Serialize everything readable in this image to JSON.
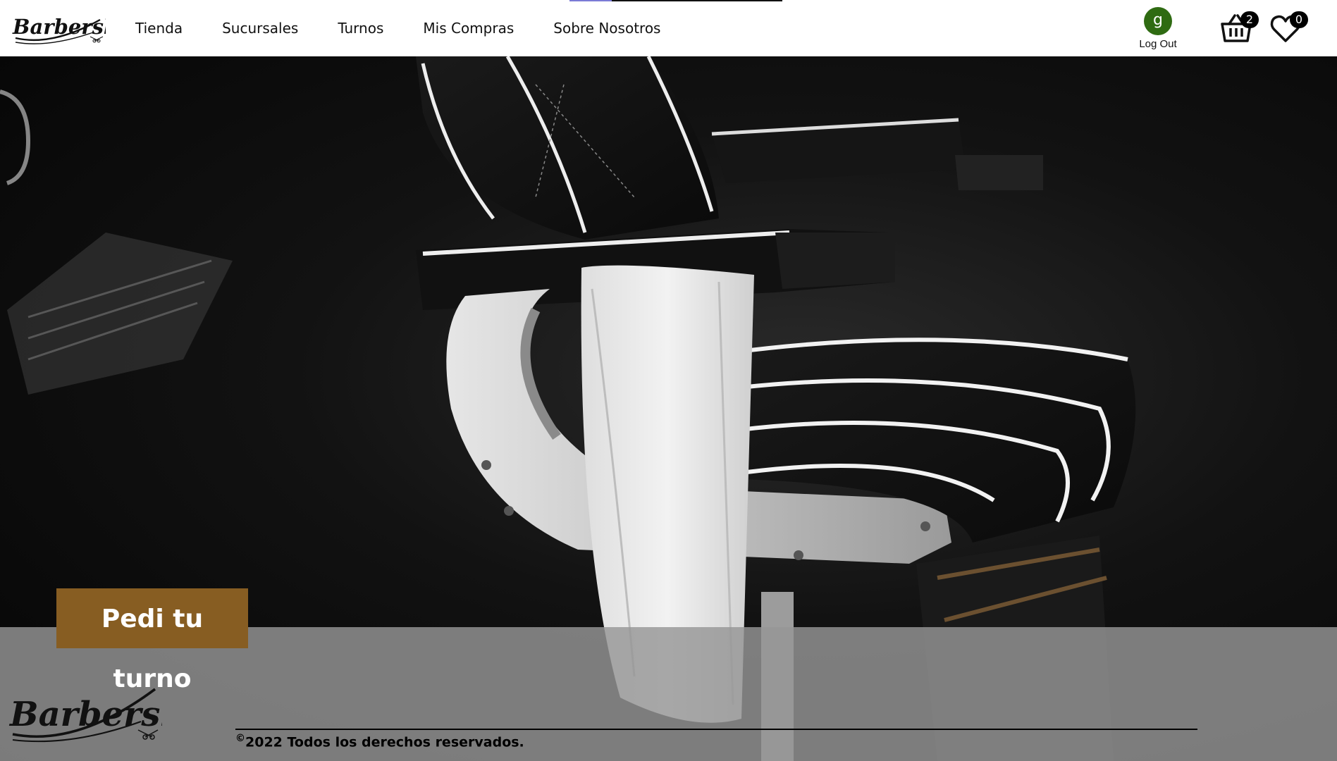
{
  "nav": {
    "brand": "Barbershop",
    "links": [
      "Tienda",
      "Sucursales",
      "Turnos",
      "Mis Compras",
      "Sobre Nosotros"
    ],
    "user": {
      "initial": "g",
      "logout_label": "Log Out",
      "avatar_color": "#2f6b12"
    },
    "cart": {
      "icon": "basket-icon",
      "count": "2"
    },
    "wishlist": {
      "icon": "heart-icon",
      "count": "0"
    }
  },
  "hero": {
    "image_icon": "barber-chair-photo",
    "cta_label": "Pedi tu turno",
    "cta_color": "#875d22"
  },
  "footer": {
    "brand": "Barbershop",
    "copyright_symbol": "©",
    "copyright_text": "2022 Todos los derechos reservados."
  }
}
